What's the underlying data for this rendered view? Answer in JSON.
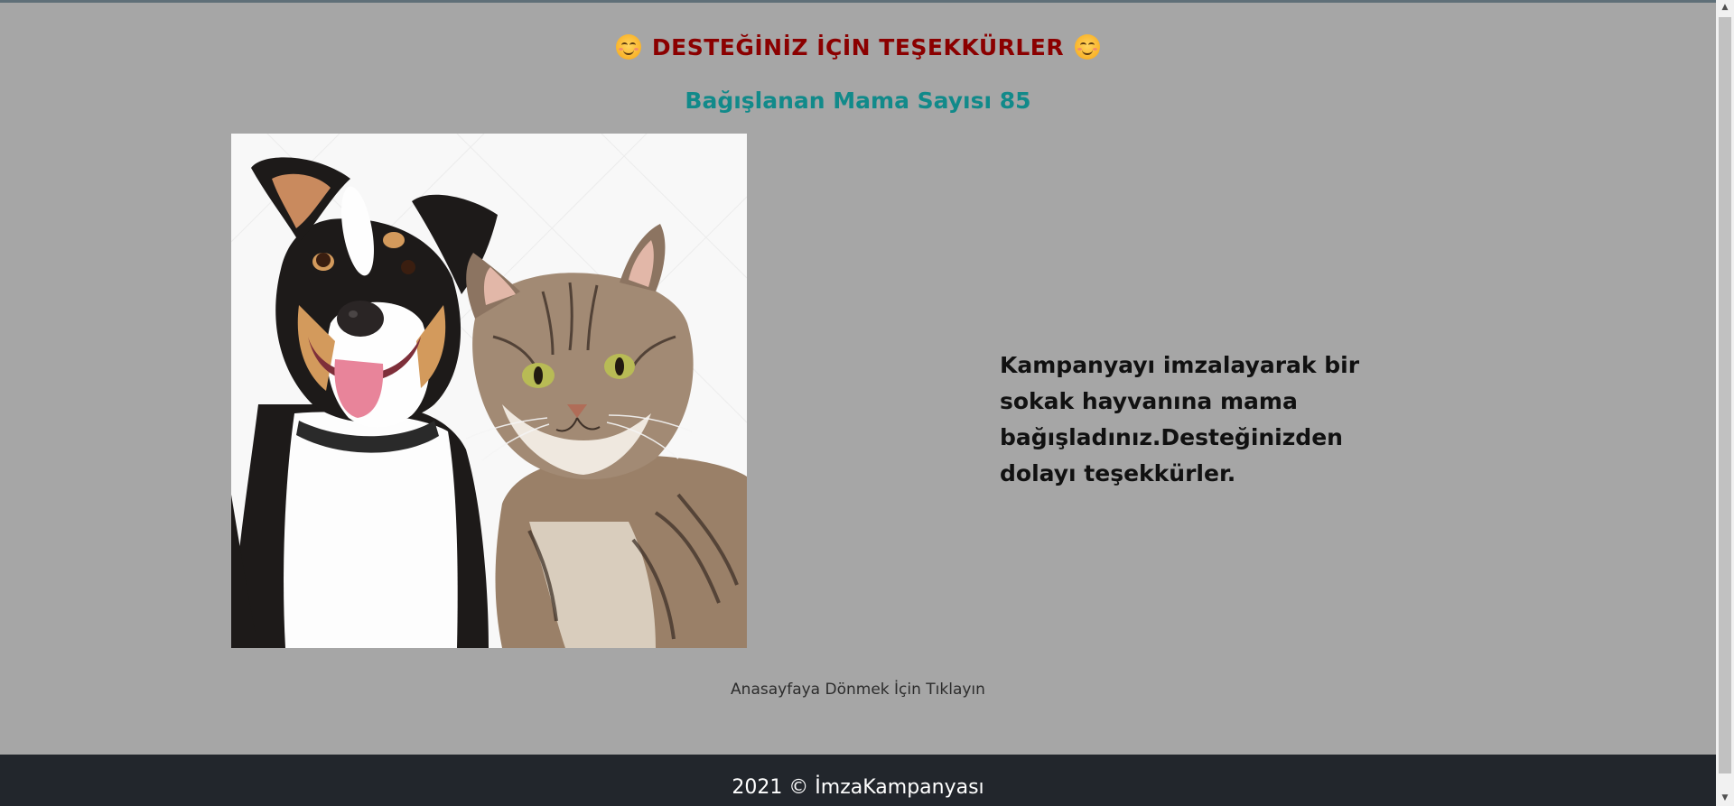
{
  "header": {
    "title": "DESTEĞİNİZ İÇİN TEŞEKKÜRLER",
    "subtitle": "Bağışlanan Mama Sayısı 85"
  },
  "main": {
    "message": "Kampanyayı imzalayarak bir sokak hayvanına mama bağışladınız.Desteğinizden dolayı teşekkürler.",
    "home_link": "Anasayfaya Dönmek İçin Tıklayın"
  },
  "footer": {
    "copyright": "2021 © İmzaKampanyası"
  },
  "colors": {
    "background": "#a6a6a6",
    "title": "#8b0000",
    "subtitle": "#118a8a",
    "footer": "#22262c"
  },
  "icons": {
    "left_emoji": "smiling-face-icon",
    "right_emoji": "smiling-face-icon"
  }
}
